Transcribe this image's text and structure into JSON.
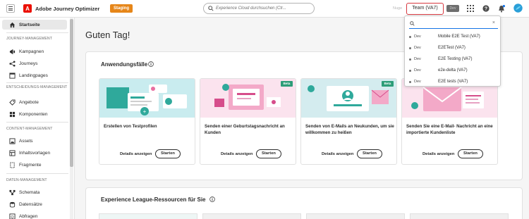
{
  "topbar": {
    "app_title": "Adobe Journey Optimizer",
    "logo_letter": "A",
    "env_badge": "Staging",
    "search_placeholder": "Experience Cloud durchsuchen (Ctr...",
    "user_name": "Nuge",
    "team_label": "Team (VA7)",
    "dev_badge": "Dev",
    "icons": [
      "menu-icon",
      "search-icon",
      "apps-grid-icon",
      "help-icon",
      "bell-icon",
      "avatar-icon"
    ]
  },
  "sidebar": {
    "home": "Startseite",
    "sections": [
      {
        "title": "JOURNEY-MANAGEMENT",
        "items": [
          "Kampagnen",
          "Journeys",
          "Landingpages"
        ]
      },
      {
        "title": "ENTSCHEIDUNGS-MANAGEMENT",
        "items": [
          "Angebote",
          "Komponenten"
        ]
      },
      {
        "title": "CONTENT-MANAGEMENT",
        "items": [
          "Assets",
          "Inhaltsvorlagen",
          "Fragmente"
        ]
      },
      {
        "title": "DATEN-MANAGEMENT",
        "items": [
          "Schemata",
          "Datensätze",
          "Abfragen"
        ]
      }
    ]
  },
  "main": {
    "greeting": "Guten Tag!",
    "usecases_title": "Anwendungsfälle",
    "usecases": [
      {
        "title": "Erstellen von Testprofilen",
        "details": "Details anzeigen",
        "start": "Starten",
        "beta": ""
      },
      {
        "title": "Senden einer Geburtstagsnachricht an Kunden",
        "details": "Details anzeigen",
        "start": "Starten",
        "beta": "Beta"
      },
      {
        "title": "Senden von E-Mails an Neukunden, um sie willkommen zu heißen",
        "details": "Details anzeigen",
        "start": "Starten",
        "beta": "Beta"
      },
      {
        "title": "Senden Sie eine E-Mail- Nachricht an eine importierte Kundenliste",
        "details": "Details anzeigen",
        "start": "Starten",
        "beta": ""
      }
    ],
    "resources_title": "Experience League-Ressourcen für Sie"
  },
  "dropdown": {
    "search_value": "",
    "items": [
      {
        "env": "Dev",
        "name": "Mobile E2E Test (VA7)"
      },
      {
        "env": "Dev",
        "name": "E2ETest (VA7)"
      },
      {
        "env": "Dev",
        "name": "E2E Testing (VA7)"
      },
      {
        "env": "Dev",
        "name": "e2e-delta (VA7)"
      },
      {
        "env": "Dev",
        "name": "E2E tests (VA7)"
      }
    ]
  },
  "colors": {
    "accent": "#1473e6",
    "adobe_red": "#eb1000",
    "staging_orange": "#e68619",
    "beta_green": "#2d9d78",
    "highlight_border": "#d7373f"
  }
}
